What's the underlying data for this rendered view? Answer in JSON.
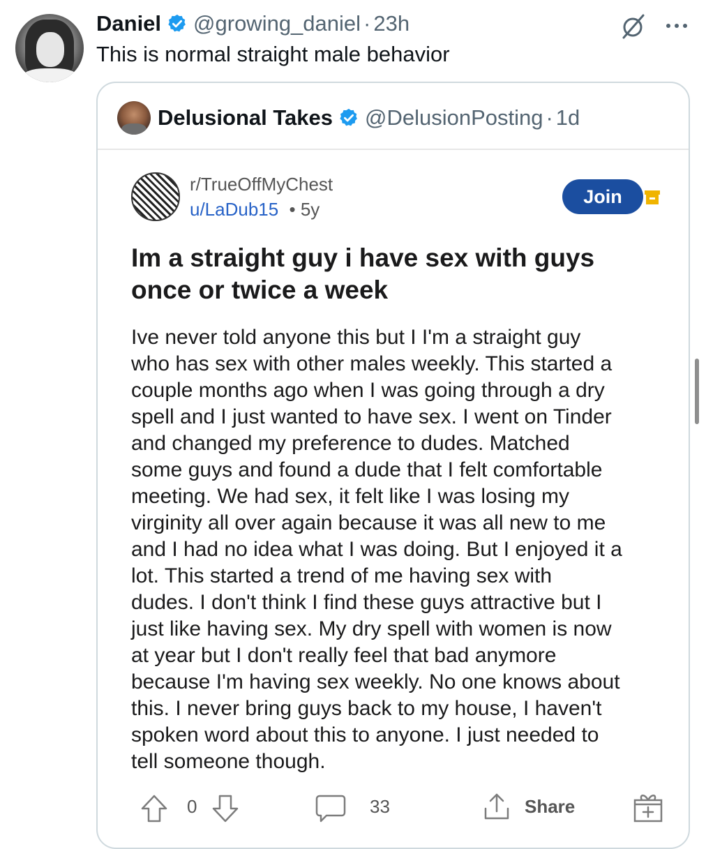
{
  "tweet": {
    "author_name": "Daniel",
    "handle": "@growing_daniel",
    "separator": "·",
    "time": "23h",
    "text": "This is normal straight male behavior"
  },
  "quote": {
    "author_name": "Delusional Takes",
    "handle": "@DelusionPosting",
    "separator": "·",
    "time": "1d"
  },
  "reddit": {
    "subreddit": "r/TrueOffMyChest",
    "user": "u/LaDub15",
    "separator": "•",
    "age": "5y",
    "join_label": "Join",
    "title_lines": [
      "Im a straight guy i have sex with guys",
      "once or twice a week"
    ],
    "body_lines": [
      "Ive never told anyone this but I I'm a straight guy",
      "who has sex with other males weekly. This started a",
      "couple months ago when I was going through a dry",
      "spell and I just wanted to have sex. I went on Tinder",
      "and changed my preference to dudes. Matched",
      "some guys and found a dude that I felt comfortable",
      "meeting. We had sex, it felt like I was losing my",
      "virginity all over again because it was all new to me",
      "and I had no idea what I was doing. But I enjoyed it a",
      "lot. This started a trend of me having sex with",
      "dudes. I don't think I find these guys attractive but I",
      "just like having sex. My dry spell with women is now",
      "at year but I don't really feel that bad anymore",
      "because I'm having sex weekly. No one knows about",
      "this. I never bring guys back to my house, I haven't",
      "spoken word about this to anyone. I just needed to",
      "tell someone though."
    ],
    "vote_count": "0",
    "comment_count": "33",
    "share_label": "Share"
  },
  "icons": {
    "verified": "verified-badge-icon",
    "grok": "grok-icon",
    "more": "more-icon",
    "archive": "archive-icon",
    "upvote": "upvote-icon",
    "downvote": "downvote-icon",
    "comment": "comment-icon",
    "share": "share-icon",
    "award": "award-icon"
  },
  "colors": {
    "verified_blue": "#1d9bf0",
    "secondary_text": "#536471",
    "reddit_link": "#2762c7",
    "join_button": "#1b4ea0",
    "archive_yellow": "#f0b400",
    "card_border": "#cfd9de"
  }
}
